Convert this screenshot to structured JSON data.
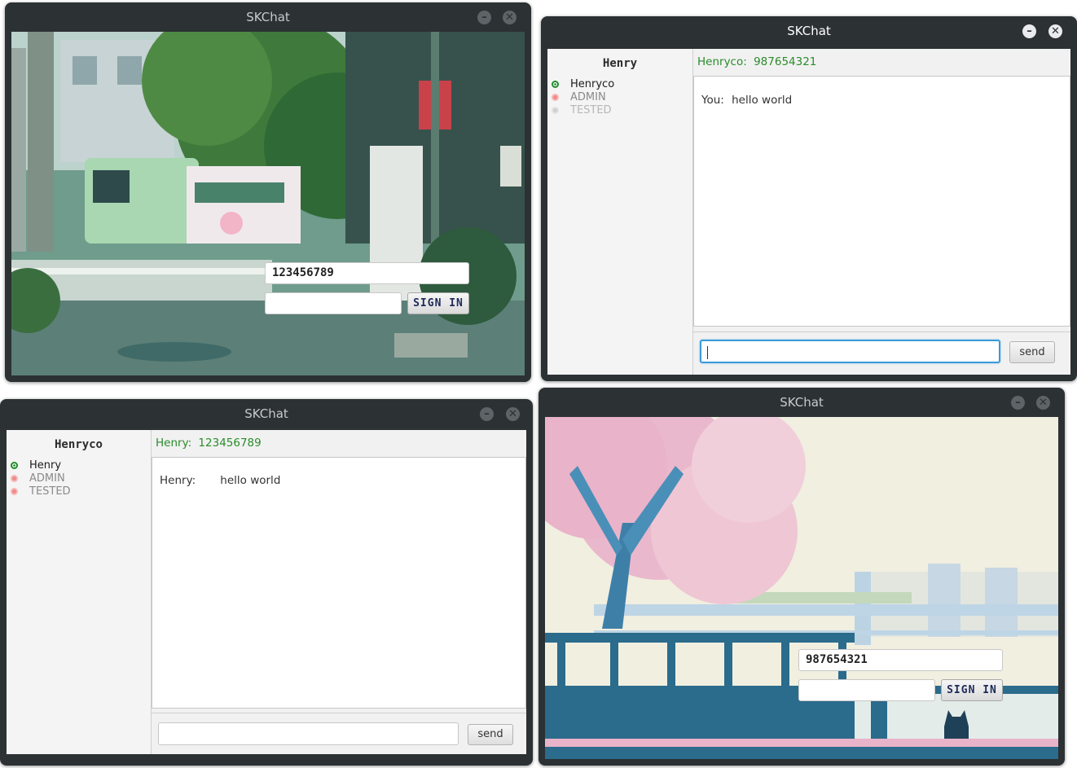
{
  "app_title": "SKChat",
  "win_controls": {
    "minimize": "–",
    "close": "✕"
  },
  "login1": {
    "username": "123456789",
    "sign_in_label": "SIGN IN"
  },
  "login2": {
    "username": "987654321",
    "sign_in_label": "SIGN IN"
  },
  "chat1": {
    "current_user": "Henry",
    "header_name": "Henryco:",
    "header_id": "987654321",
    "contacts": [
      {
        "name": "Henryco",
        "status": "online"
      },
      {
        "name": "ADMIN",
        "status": "offline"
      },
      {
        "name": "TESTED",
        "status": "idle"
      }
    ],
    "message": {
      "sender": "You:",
      "text": "hello world"
    },
    "send_label": "send"
  },
  "chat2": {
    "current_user": "Henryco",
    "header_name": "Henry:",
    "header_id": "123456789",
    "contacts": [
      {
        "name": "Henry",
        "status": "online"
      },
      {
        "name": "ADMIN",
        "status": "offline"
      },
      {
        "name": "TESTED",
        "status": "offline"
      }
    ],
    "message": {
      "sender": "Henry:",
      "text": "hello world"
    },
    "send_label": "send"
  },
  "colors": {
    "online": "#1e8b2a",
    "offline": "#f08a8a",
    "header_green": "#2a8c2a",
    "titlebar": "#2c3134"
  }
}
